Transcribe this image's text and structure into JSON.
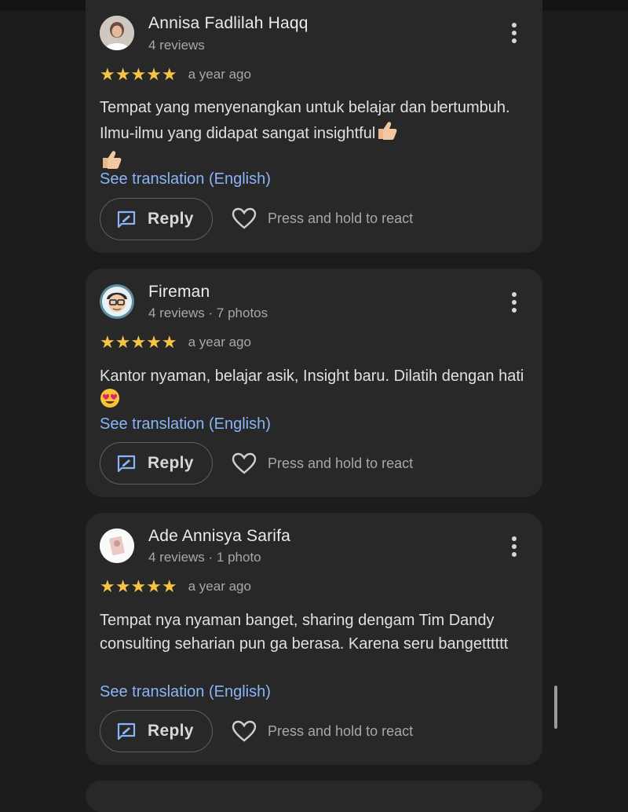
{
  "reviews": [
    {
      "name": "Annisa Fadlilah Haqq",
      "meta": "4 reviews",
      "rating": 5,
      "stars": "★★★★★",
      "when": "a year ago",
      "text": "Tempat yang menyenangkan untuk belajar dan bertumbuh. Ilmu-ilmu yang didapat sangat insightful",
      "translate": "See translation (English)",
      "reply": "Reply",
      "react": "Press and hold to react"
    },
    {
      "name": "Fireman",
      "meta": "4 reviews · 7 photos",
      "rating": 5,
      "stars": "★★★★★",
      "when": "a year ago",
      "text": "Kantor nyaman, belajar asik, Insight baru. Dilatih dengan hati",
      "translate": "See translation (English)",
      "reply": "Reply",
      "react": "Press and hold to react"
    },
    {
      "name": "Ade Annisya Sarifa",
      "meta": "4 reviews · 1 photo",
      "rating": 5,
      "stars": "★★★★★",
      "when": "a year ago",
      "text": "Tempat nya nyaman banget, sharing dengam Tim Dandy consulting seharian pun ga berasa. Karena seru bangetttttt",
      "translate": "See translation (English)",
      "reply": "Reply",
      "react": "Press and hold to react"
    }
  ],
  "colors": {
    "background": "#1c1c1c",
    "card": "#282828",
    "star": "#f6c344",
    "link": "#8ab4f8"
  }
}
